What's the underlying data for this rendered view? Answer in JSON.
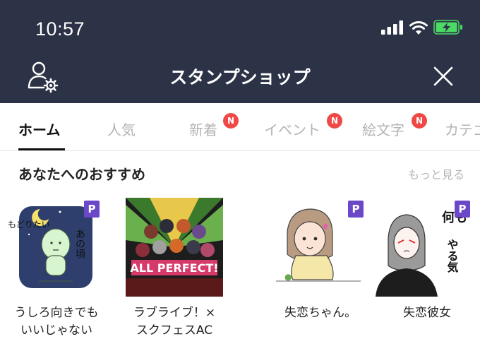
{
  "status_bar": {
    "time": "10:57"
  },
  "nav": {
    "title": "スタンプショップ"
  },
  "tabs": [
    {
      "label": "ホーム",
      "badge": ""
    },
    {
      "label": "人気",
      "badge": ""
    },
    {
      "label": "新着",
      "badge": "N"
    },
    {
      "label": "イベント",
      "badge": "N"
    },
    {
      "label": "絵文字",
      "badge": "N"
    },
    {
      "label": "カテゴ",
      "badge": ""
    }
  ],
  "section": {
    "title": "あなたへのおすすめ",
    "more": "もっと見る"
  },
  "stickers": [
    {
      "name": "うしろ向きでも\nいいじゃない",
      "premium": "P",
      "art_text": "あの頃に\nもどりたい"
    },
    {
      "name": "ラブライブ！×\nスクフェスAC",
      "premium": "",
      "art_text": "ALL PERFECT!"
    },
    {
      "name": "失恋ちゃん。",
      "premium": "P",
      "art_text": ""
    },
    {
      "name": "失恋彼女",
      "premium": "P",
      "art_text": "何も\nやる気しない"
    }
  ],
  "colors": {
    "header_bg": "#2c3347",
    "badge_red": "#f04846",
    "premium_purple": "#6b48c8",
    "battery_green": "#4cd964"
  }
}
